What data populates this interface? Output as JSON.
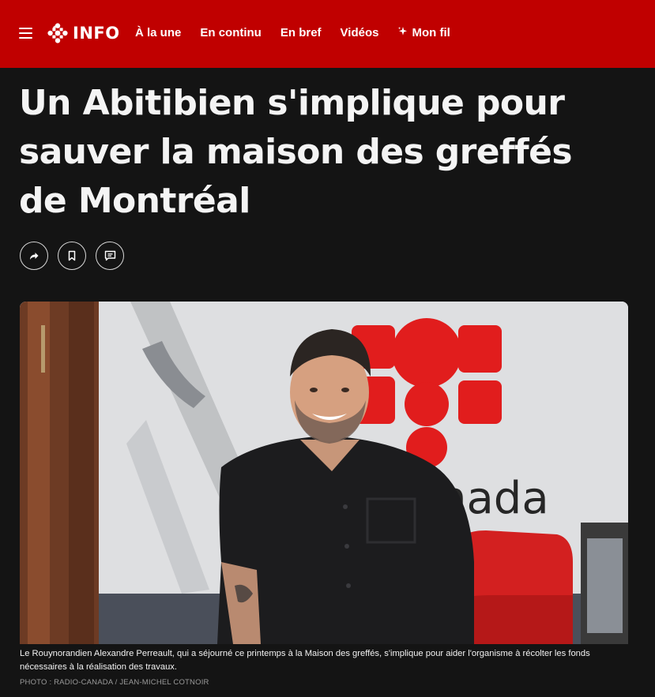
{
  "header": {
    "logo_text": "INFO",
    "nav": [
      {
        "label": "À la une"
      },
      {
        "label": "En continu"
      },
      {
        "label": "En bref"
      },
      {
        "label": "Vidéos"
      },
      {
        "label": "Mon fil"
      }
    ]
  },
  "article": {
    "headline": "Un Abitibien s'implique pour sauver la maison des greffés de Montréal",
    "actions": [
      "share-icon",
      "bookmark-icon",
      "comment-icon"
    ],
    "photo": {
      "wall_text": "nada",
      "caption": "Le Rouynorandien Alexandre Perreault, qui a séjourné ce printemps à la Maison des greffés, s'implique pour aider l'organisme à récolter les fonds nécessaires à la réalisation des travaux.",
      "credit": "PHOTO : RADIO-CANADA / JEAN-MICHEL COTNOIR"
    }
  },
  "colors": {
    "brand_red": "#c00000",
    "background": "#141414",
    "logo_red": "#e11d1d"
  }
}
